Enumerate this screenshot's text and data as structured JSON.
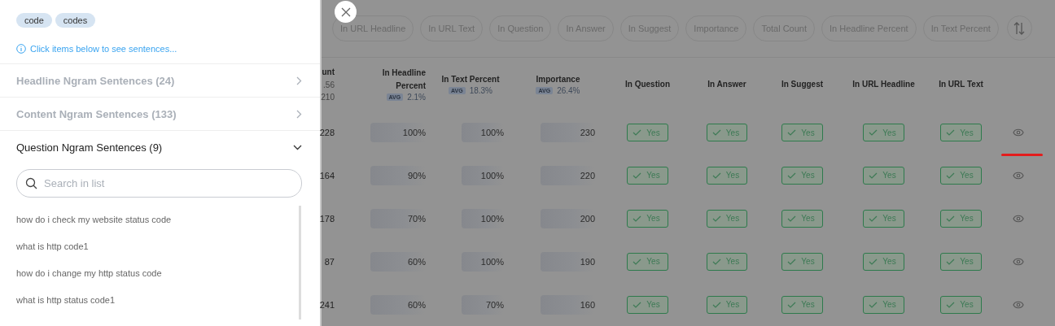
{
  "drawer": {
    "tags": [
      "code",
      "codes"
    ],
    "hint": "Click items below to see sentences...",
    "sections": [
      {
        "title": "Headline Ngram Sentences (24)",
        "expanded": false
      },
      {
        "title": "Content Ngram Sentences (133)",
        "expanded": false
      },
      {
        "title": "Question Ngram Sentences (9)",
        "expanded": true,
        "search": {
          "placeholder": "Search in list"
        },
        "sentences": [
          "how do i check my website status code",
          "what is http code1",
          "how do i change my http status code",
          "what is http status code1"
        ]
      }
    ]
  },
  "sort_chips": [
    "In URL Headline",
    "In URL Text",
    "In Question",
    "In Answer",
    "In Suggest",
    "Importance",
    "Total Count",
    "In Headline Percent",
    "In Text Percent"
  ],
  "table": {
    "columns": [
      {
        "title": "unt",
        "stats": [
          ".56",
          "210"
        ]
      },
      {
        "title": "In Headline Percent",
        "badge": "AVG",
        "avg": "2.1%"
      },
      {
        "title": "In Text Percent",
        "badge": "AVG",
        "avg": "18.3%"
      },
      {
        "title": "Importance",
        "badge": "AVG",
        "avg": "26.4%"
      },
      {
        "title": "In Question"
      },
      {
        "title": "In Answer"
      },
      {
        "title": "In Suggest"
      },
      {
        "title": "In URL Headline"
      },
      {
        "title": "In URL Text"
      }
    ],
    "rows": [
      {
        "count": "228",
        "headline": "100%",
        "text": "100%",
        "importance": "230",
        "flags": [
          "Yes",
          "Yes",
          "Yes",
          "Yes",
          "Yes"
        ],
        "marked": true
      },
      {
        "count": "164",
        "headline": "90%",
        "text": "100%",
        "importance": "220",
        "flags": [
          "Yes",
          "Yes",
          "Yes",
          "Yes",
          "Yes"
        ],
        "marked": false
      },
      {
        "count": "178",
        "headline": "70%",
        "text": "100%",
        "importance": "200",
        "flags": [
          "Yes",
          "Yes",
          "Yes",
          "Yes",
          "Yes"
        ],
        "marked": false
      },
      {
        "count": "87",
        "headline": "60%",
        "text": "100%",
        "importance": "190",
        "flags": [
          "Yes",
          "Yes",
          "Yes",
          "Yes",
          "Yes"
        ],
        "marked": false
      },
      {
        "count": "241",
        "headline": "60%",
        "text": "70%",
        "importance": "160",
        "flags": [
          "Yes",
          "Yes",
          "Yes",
          "Yes",
          "Yes"
        ],
        "marked": false
      }
    ]
  }
}
